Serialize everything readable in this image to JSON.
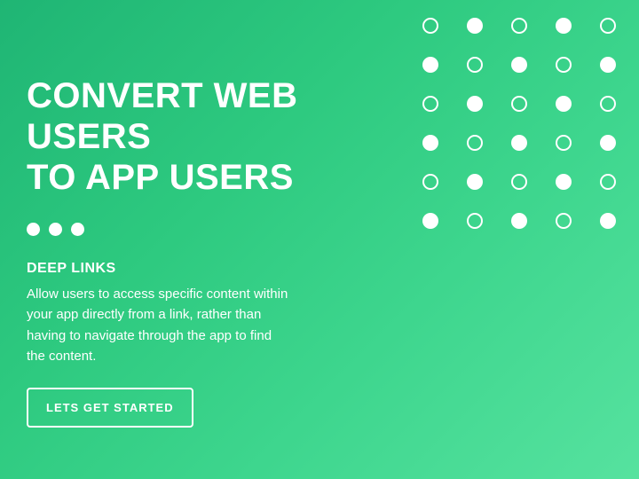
{
  "hero": {
    "headline_line1": "CONVERT WEB USERS",
    "headline_line2": "TO APP USERS",
    "subheading": "DEEP LINKS",
    "body": "Allow users to access specific content within your app directly from a link, rather than having to navigate through the app to find the content.",
    "cta_label": "LETS GET STARTED"
  }
}
